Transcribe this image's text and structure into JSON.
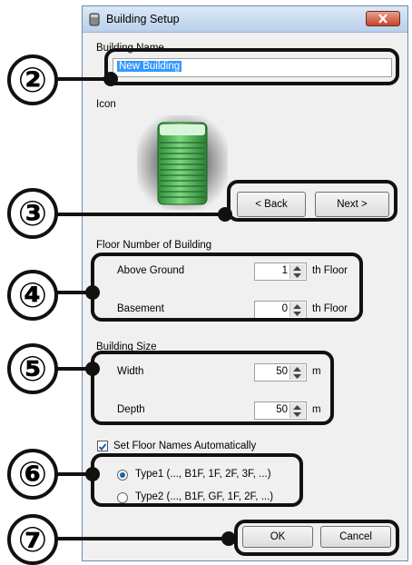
{
  "dialog": {
    "title": "Building Setup",
    "building_name_label": "Building Name",
    "building_name_value": "New Building",
    "icon_label": "Icon",
    "back_button": "< Back",
    "next_button": "Next >",
    "floor_section_label": "Floor Number of Building",
    "above_ground_label": "Above Ground",
    "above_ground_value": "1",
    "above_ground_unit": "th Floor",
    "basement_label": "Basement",
    "basement_value": "0",
    "basement_unit": "th Floor",
    "size_section_label": "Building Size",
    "width_label": "Width",
    "width_value": "50",
    "width_unit": "m",
    "depth_label": "Depth",
    "depth_value": "50",
    "depth_unit": "m",
    "auto_names_label": "Set Floor Names Automatically",
    "auto_names_checked": true,
    "type1_label": "Type1 (..., B1F, 1F, 2F, 3F, ...)",
    "type2_label": "Type2 (..., B1F, GF, 1F, 2F, ...)",
    "selected_type": "type1",
    "ok_button": "OK",
    "cancel_button": "Cancel"
  },
  "callouts": [
    "②",
    "③",
    "④",
    "⑤",
    "⑥",
    "⑦"
  ],
  "colors": {
    "titlebar": "#c7daf0",
    "dialog_bg": "#f0f0f0",
    "selection": "#3399ff",
    "building_icon": "#3fae49",
    "close_button": "#c5442a",
    "callout": "#111111"
  },
  "icons": [
    "building-icon",
    "close-icon"
  ]
}
